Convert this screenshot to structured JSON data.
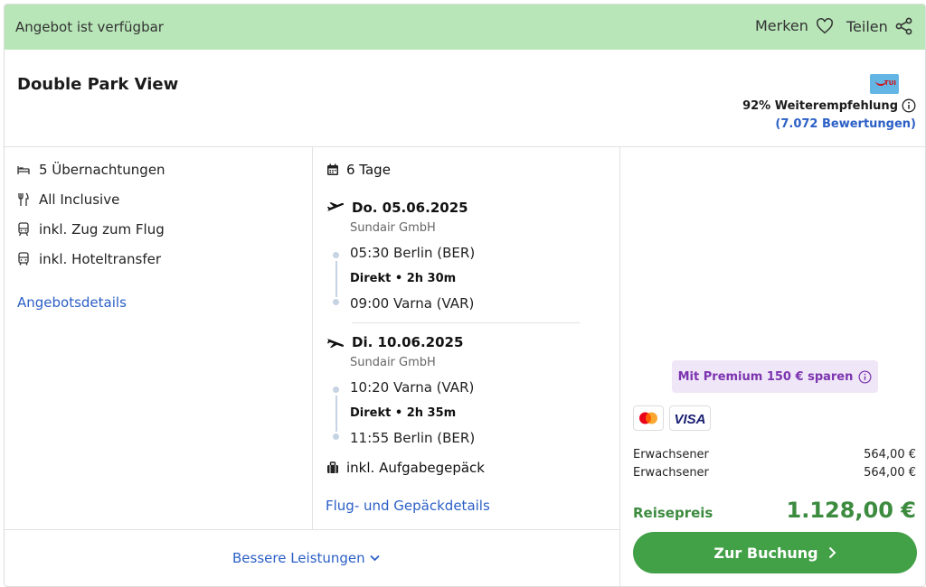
{
  "status": {
    "text": "Angebot ist verfügbar"
  },
  "header_actions": {
    "save_label": "Merken",
    "share_label": "Teilen"
  },
  "hotel": {
    "name": "Double Park View",
    "operator_logo": "TUI",
    "recommendation": "92% Weiterempfehlung",
    "reviews": "(7.072 Bewertungen)"
  },
  "features": [
    {
      "icon": "bed-icon",
      "label": "5 Übernachtungen"
    },
    {
      "icon": "cutlery-icon",
      "label": "All Inclusive"
    },
    {
      "icon": "train-icon",
      "label": "inkl. Zug zum Flug"
    },
    {
      "icon": "bus-icon",
      "label": "inkl. Hoteltransfer"
    }
  ],
  "offer_details_link": "Angebotsdetails",
  "trip": {
    "duration": "6 Tage",
    "outbound": {
      "date": "Do. 05.06.2025",
      "airline": "Sundair GmbH",
      "departure": "05:30 Berlin (BER)",
      "info": "Direkt • 2h 30m",
      "arrival": "09:00 Varna (VAR)"
    },
    "return": {
      "date": "Di. 10.06.2025",
      "airline": "Sundair GmbH",
      "departure": "10:20 Varna (VAR)",
      "info": "Direkt • 2h 35m",
      "arrival": "11:55 Berlin (BER)"
    },
    "baggage": "inkl. Aufgabegepäck",
    "details_link": "Flug- und Gepäckdetails"
  },
  "pricing": {
    "premium": "Mit Premium 150 € sparen",
    "payment_methods": [
      "Mastercard",
      "VISA"
    ],
    "passengers": [
      {
        "label": "Erwachsener",
        "price": "564,00 €"
      },
      {
        "label": "Erwachsener",
        "price": "564,00 €"
      }
    ],
    "total_label": "Reisepreis",
    "total": "1.128,00 €",
    "book_button": "Zur Buchung"
  },
  "better_services": "Bessere Leistungen",
  "colors": {
    "status_bg": "#b8e6b8",
    "link": "#2b5fc6",
    "accent_green": "#42a046",
    "price_green": "#3c8b3f",
    "premium_bg": "#efe6f7",
    "premium_text": "#7c34b0"
  }
}
